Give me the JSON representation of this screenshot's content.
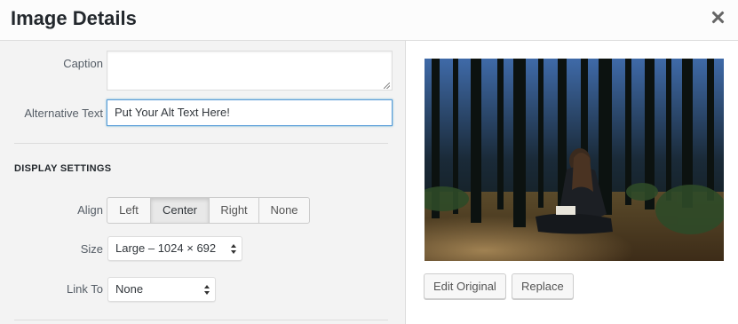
{
  "header": {
    "title": "Image Details",
    "close_icon": "close-icon"
  },
  "fields": {
    "caption_label": "Caption",
    "caption_value": "",
    "alt_label": "Alternative Text",
    "alt_value": "Put Your Alt Text Here!"
  },
  "display": {
    "section_title": "DISPLAY SETTINGS",
    "align_label": "Align",
    "align_options": [
      "Left",
      "Center",
      "Right",
      "None"
    ],
    "align_selected": "Center",
    "size_label": "Size",
    "size_value": "Large – 1024 × 692",
    "link_label": "Link To",
    "link_value": "None"
  },
  "preview": {
    "edit_original_label": "Edit Original",
    "replace_label": "Replace"
  },
  "colors": {
    "focus_border": "#5b9dd9",
    "panel_bg": "#f3f3f3"
  }
}
